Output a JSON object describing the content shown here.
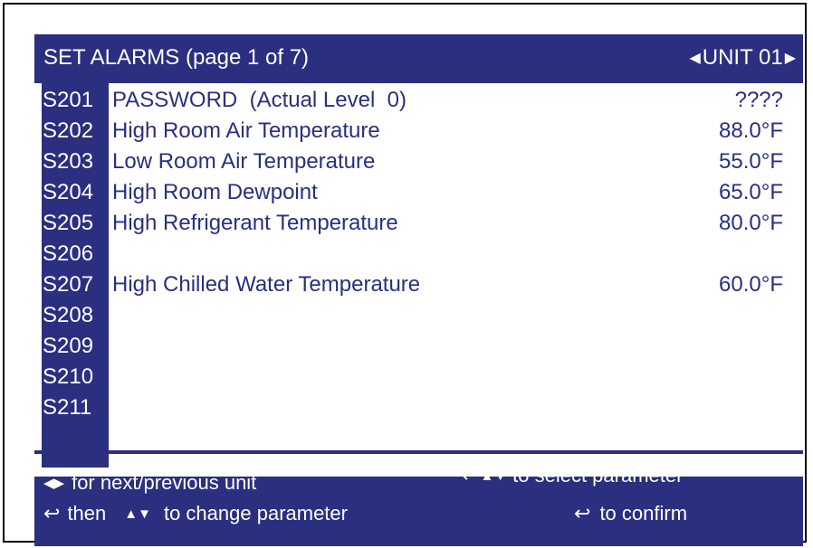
{
  "header": {
    "title": "SET ALARMS (page 1 of 7)",
    "unit_label": "UNIT 01",
    "prev_icon": "◀",
    "next_icon": "▶"
  },
  "params": [
    {
      "code": "S201",
      "label": "PASSWORD  (Actual Level  0)",
      "value": "????"
    },
    {
      "code": "S202",
      "label": "High Room Air Temperature",
      "value": "88.0°F"
    },
    {
      "code": "S203",
      "label": "Low Room Air Temperature",
      "value": "55.0°F"
    },
    {
      "code": "S204",
      "label": "High Room Dewpoint",
      "value": "65.0°F"
    },
    {
      "code": "S205",
      "label": "High Refrigerant Temperature",
      "value": "80.0°F"
    },
    {
      "code": "S206",
      "label": "",
      "value": ""
    },
    {
      "code": "S207",
      "label": "High Chilled Water Temperature",
      "value": "60.0°F"
    },
    {
      "code": "S208",
      "label": "",
      "value": ""
    },
    {
      "code": "S209",
      "label": "",
      "value": ""
    },
    {
      "code": "S210",
      "label": "",
      "value": ""
    },
    {
      "code": "S211",
      "label": "",
      "value": ""
    }
  ],
  "footer": {
    "next_prev_text": "for next/previous unit",
    "select_text": "to select parameter",
    "then_text": "then",
    "change_text": "to change parameter",
    "confirm_text": "to confirm",
    "icons": {
      "left_right": "◀▶",
      "enter": "↩",
      "up_down": "▲▼"
    }
  },
  "colors": {
    "panel": "#2a2f7f",
    "text_light": "#ffffff",
    "content_bg": "#ffffff"
  }
}
